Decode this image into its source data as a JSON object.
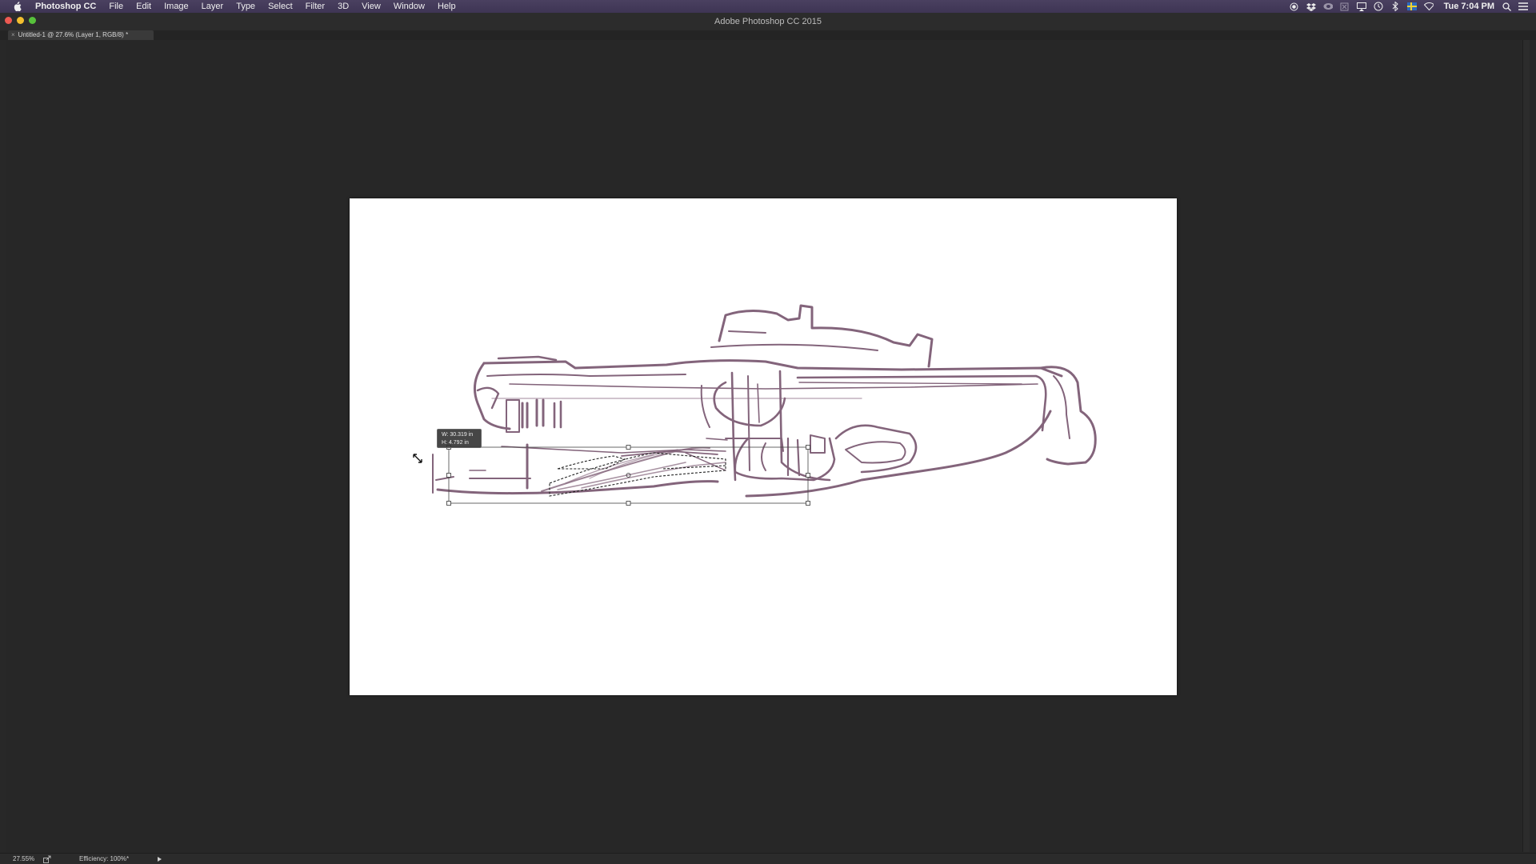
{
  "menubar": {
    "app_name": "Photoshop CC",
    "items": [
      "File",
      "Edit",
      "Image",
      "Layer",
      "Type",
      "Select",
      "Filter",
      "3D",
      "View",
      "Window",
      "Help"
    ],
    "clock": "Tue 7:04 PM",
    "status_icons": [
      "record-icon",
      "dropbox-icon",
      "creative-cloud-icon",
      "cast-icon",
      "airplay-icon",
      "time-machine-icon",
      "bluetooth-icon",
      "flag-icon",
      "wifi-icon"
    ]
  },
  "window": {
    "title": "Adobe Photoshop CC 2015"
  },
  "document": {
    "tab_label": "Untitled-1 @ 27.6% (Layer 1, RGB/8) *",
    "tab_close": "×"
  },
  "transform": {
    "width_readout": "W: 30.319 in",
    "height_readout": "H: 4.792 in"
  },
  "status": {
    "zoom": "27.55%",
    "efficiency": "Efficiency: 100%*"
  },
  "colors": {
    "menubar": "#433a5a",
    "sketch_stroke": "#6e4a64",
    "canvas": "#ffffff",
    "workspace": "#272727"
  }
}
